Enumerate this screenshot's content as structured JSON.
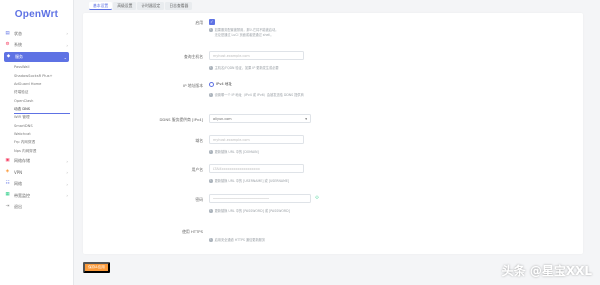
{
  "app": {
    "logo": "OpenWrt"
  },
  "sidebar": {
    "items": [
      {
        "label": "状态",
        "icon": "status-icon"
      },
      {
        "label": "系统",
        "icon": "system-icon"
      },
      {
        "label": "服务",
        "icon": "services-icon",
        "active": true
      },
      {
        "label": "网络存储",
        "icon": "storage-icon"
      },
      {
        "label": "VPN",
        "icon": "vpn-icon"
      },
      {
        "label": "网络",
        "icon": "network-icon"
      },
      {
        "label": "带宽监控",
        "icon": "bandwidth-icon"
      },
      {
        "label": "退出",
        "icon": "logout-icon"
      }
    ],
    "services_sub": [
      "PassWall",
      "ShadowSocksR Plus+",
      "AdGuard Home",
      "终端验证",
      "OpenClash",
      "动态 DNS",
      "WiFi 管理",
      "SmartDNS",
      "Watchcat",
      "Frp 内网穿透",
      "Nps 内网穿透"
    ],
    "current_sub": "动态 DNS"
  },
  "tabs": [
    {
      "label": "基本设置",
      "active": true
    },
    {
      "label": "高级设置"
    },
    {
      "label": "计时器设定"
    },
    {
      "label": "日志查看器"
    }
  ],
  "form": {
    "enable": {
      "label": "启用",
      "checked": true,
      "hint_line1": "如果服务配置被禁用，那么它将不能被启动。",
      "hint_line2": "无论是通过 LuCI 页面或者是通过 shell。"
    },
    "lookup_host": {
      "label": "查询主机名",
      "placeholder": "myhost.example.com",
      "hint": "主机名/FQDN 验证，如果 IP 更新发生或必要"
    },
    "ip_version": {
      "label": "IP 地址版本",
      "option": "IPv4 地址",
      "hint": "设置哪一个 IP 地址（IPv4 或 IPv6）会被发送给 DDNS 提供商"
    },
    "provider": {
      "label": "DDNS 服务提供商 [IPv4]",
      "value": "aliyun.com"
    },
    "domain": {
      "label": "域名",
      "placeholder": "myhost.example.com",
      "hint": "更新替换 URL 中的 [DOMAIN]"
    },
    "username": {
      "label": "用户名",
      "placeholder": "LTAI4xxxxxxxxxxxxxxxxxxx",
      "hint": "更新替换 URL 中的 [USERNAME] 或 [USERNAME]"
    },
    "password": {
      "label": "密码",
      "placeholder": "••••••••••••••••••••••••••••",
      "hint": "更新替换 URL 中的 [PASSWORD] 或 [PASSWORD]"
    },
    "https": {
      "label": "使用 HTTPS",
      "hint": "启用安全通道 HTTPS 通信更新服务"
    }
  },
  "actions": {
    "save_label": "保存&应用"
  },
  "watermark": {
    "text": "头条 @星宝XXL"
  },
  "colors": {
    "accent": "#5e72e4",
    "save": "#fb9a3a",
    "eye": "#2dce89"
  }
}
